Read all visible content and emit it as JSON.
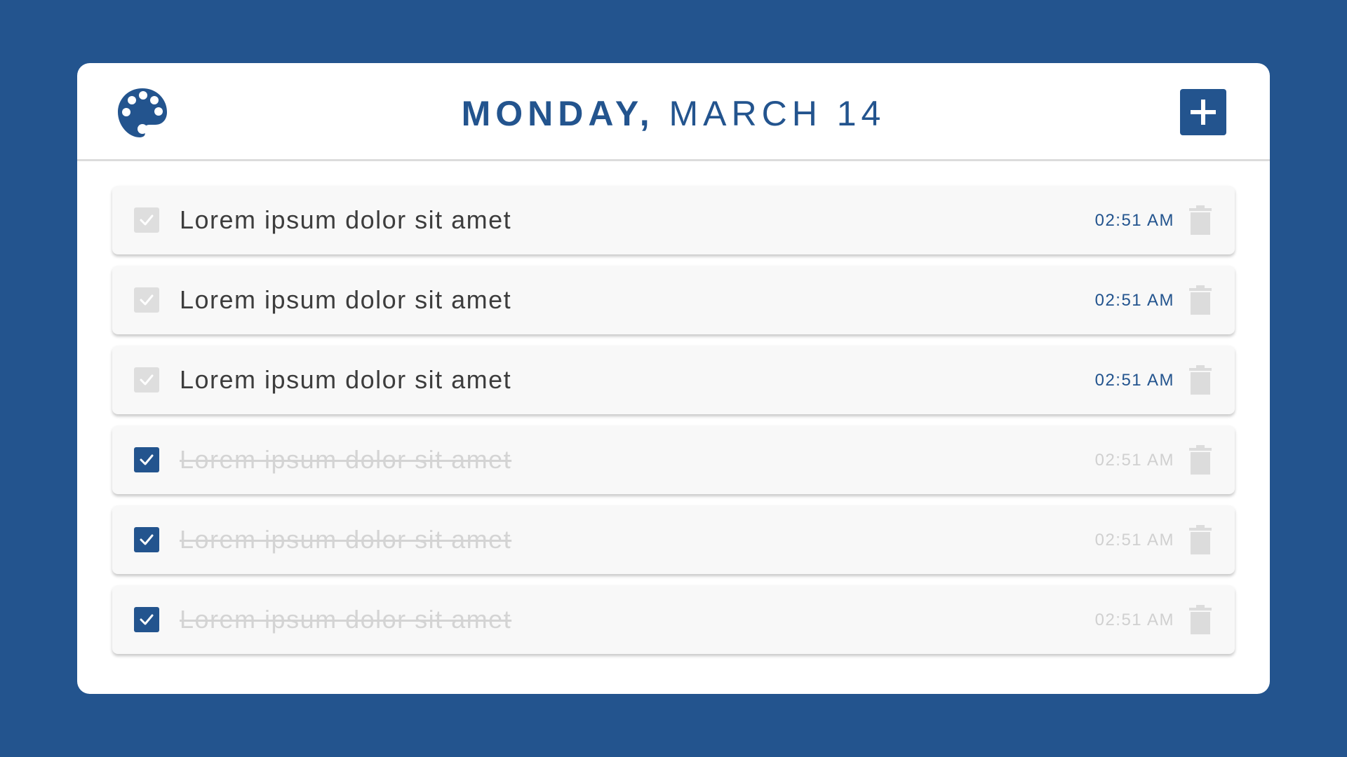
{
  "header": {
    "day": "MONDAY,",
    "date": "MARCH 14",
    "palette_icon": "palette-icon",
    "add_icon": "plus-icon"
  },
  "colors": {
    "background": "#23548e",
    "accent": "#23548e",
    "card": "#ffffff",
    "row": "#f8f8f8",
    "done_text": "#d4d4d4",
    "unchecked_box": "#dedede"
  },
  "tasks": [
    {
      "text": "Lorem ipsum dolor sit amet",
      "time": "02:51 AM",
      "done": false
    },
    {
      "text": "Lorem ipsum dolor sit amet",
      "time": "02:51 AM",
      "done": false
    },
    {
      "text": "Lorem ipsum dolor sit amet",
      "time": "02:51 AM",
      "done": false
    },
    {
      "text": "Lorem ipsum dolor sit amet",
      "time": "02:51 AM",
      "done": true
    },
    {
      "text": "Lorem ipsum dolor sit amet",
      "time": "02:51 AM",
      "done": true
    },
    {
      "text": "Lorem ipsum dolor sit amet",
      "time": "02:51 AM",
      "done": true
    }
  ]
}
